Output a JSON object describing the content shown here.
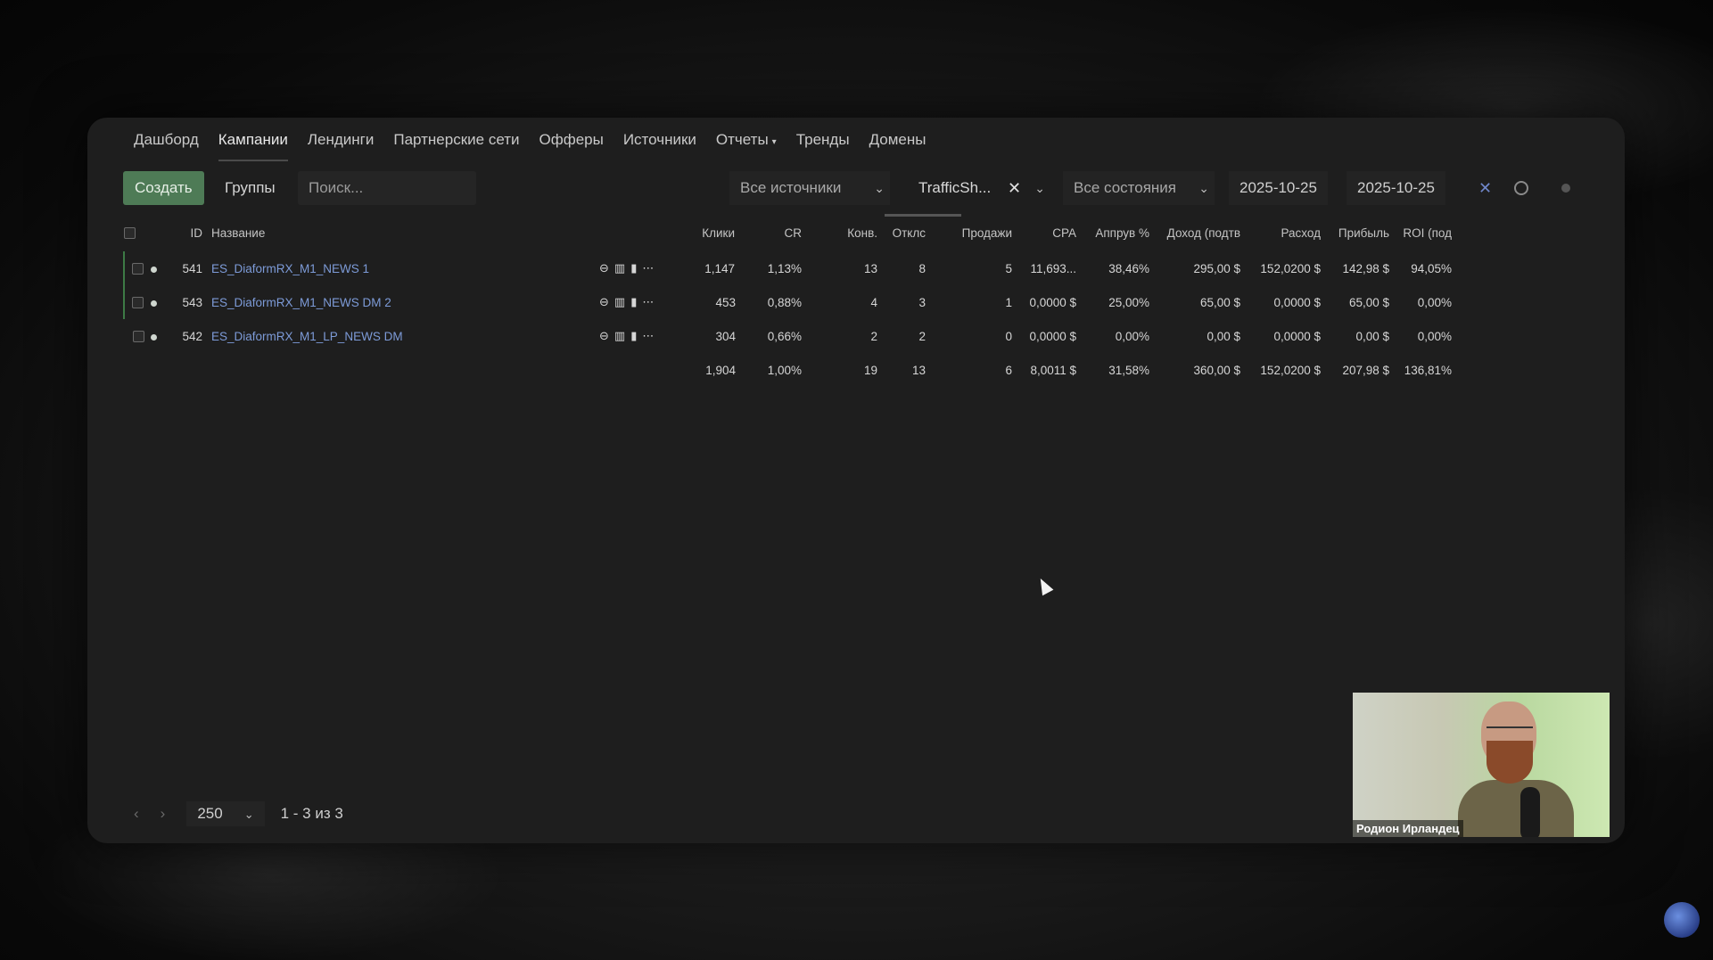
{
  "nav": {
    "items": [
      "Дашборд",
      "Кампании",
      "Лендинги",
      "Партнерские сети",
      "Офферы",
      "Источники",
      "Отчеты",
      "Тренды",
      "Домены"
    ],
    "active": "Кампании"
  },
  "toolbar": {
    "create_label": "Создать",
    "groups_label": "Группы",
    "search_placeholder": "Поиск...",
    "sources_select": "Все источники",
    "traffic_filter": "TrafficSh...",
    "states_select": "Все состояния",
    "date_from": "2025-10-25",
    "date_sep": "-",
    "date_to": "2025-10-25"
  },
  "table": {
    "headers": {
      "id": "ID",
      "name": "Название",
      "clicks": "Клики",
      "cr": "CR",
      "conv": "Конв.",
      "rej": "Отклс",
      "sales": "Продажи",
      "cpa": "CPA",
      "approve": "Аппрув %",
      "revenue": "Доход (подтв",
      "cost": "Расход",
      "profit": "Прибыль",
      "roi": "ROI (под"
    },
    "rows": [
      {
        "id": "541",
        "name": "ES_DiaformRX_M1_NEWS 1",
        "clicks": "1,147",
        "cr": "1,13%",
        "conv": "13",
        "rej": "8",
        "sales": "5",
        "cpa": "11,693...",
        "approve": "38,46%",
        "revenue": "295,00 $",
        "cost": "152,0200 $",
        "profit": "142,98 $",
        "roi": "94,05%"
      },
      {
        "id": "543",
        "name": "ES_DiaformRX_M1_NEWS DM 2",
        "clicks": "453",
        "cr": "0,88%",
        "conv": "4",
        "rej": "3",
        "sales": "1",
        "cpa": "0,0000 $",
        "approve": "25,00%",
        "revenue": "65,00 $",
        "cost": "0,0000 $",
        "profit": "65,00 $",
        "roi": "0,00%"
      },
      {
        "id": "542",
        "name": "ES_DiaformRX_M1_LP_NEWS DM",
        "clicks": "304",
        "cr": "0,66%",
        "conv": "2",
        "rej": "2",
        "sales": "0",
        "cpa": "0,0000 $",
        "approve": "0,00%",
        "revenue": "0,00 $",
        "cost": "0,0000 $",
        "profit": "0,00 $",
        "roi": "0,00%"
      }
    ],
    "totals": {
      "clicks": "1,904",
      "cr": "1,00%",
      "conv": "19",
      "rej": "13",
      "sales": "6",
      "cpa": "8,0011 $",
      "approve": "31,58%",
      "revenue": "360,00 $",
      "cost": "152,0200 $",
      "profit": "207,98 $",
      "roi": "136,81%"
    }
  },
  "pager": {
    "page_size": "250",
    "range": "1 - 3 из 3"
  },
  "webcam": {
    "name": "Родион Ирландец"
  },
  "colors": {
    "create": "#4e7b56",
    "link": "#7d9bd8",
    "roi_positive": "#74b96f"
  }
}
